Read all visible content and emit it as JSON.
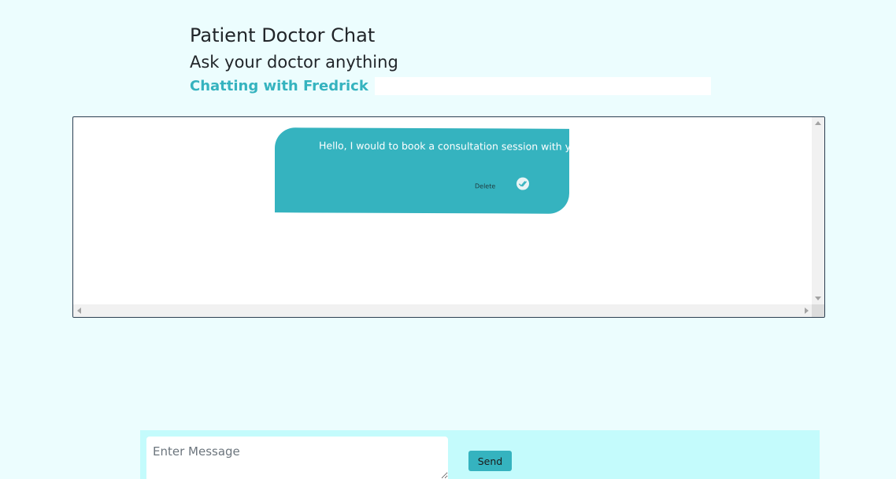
{
  "header": {
    "title": "Patient Doctor Chat",
    "subtitle": "Ask your doctor anything",
    "chatting_with": "Chatting with Fredrick"
  },
  "messages": [
    {
      "text": "Hello, I would to book a consultation session with you",
      "delete_label": "Delete",
      "status_icon": "double-check-icon"
    }
  ],
  "composer": {
    "placeholder": "Enter Message",
    "value": "",
    "send_label": "Send"
  },
  "colors": {
    "page_background": "#ecfdfe",
    "accent": "#35b3bf",
    "composer_background": "#c4fbfc"
  }
}
